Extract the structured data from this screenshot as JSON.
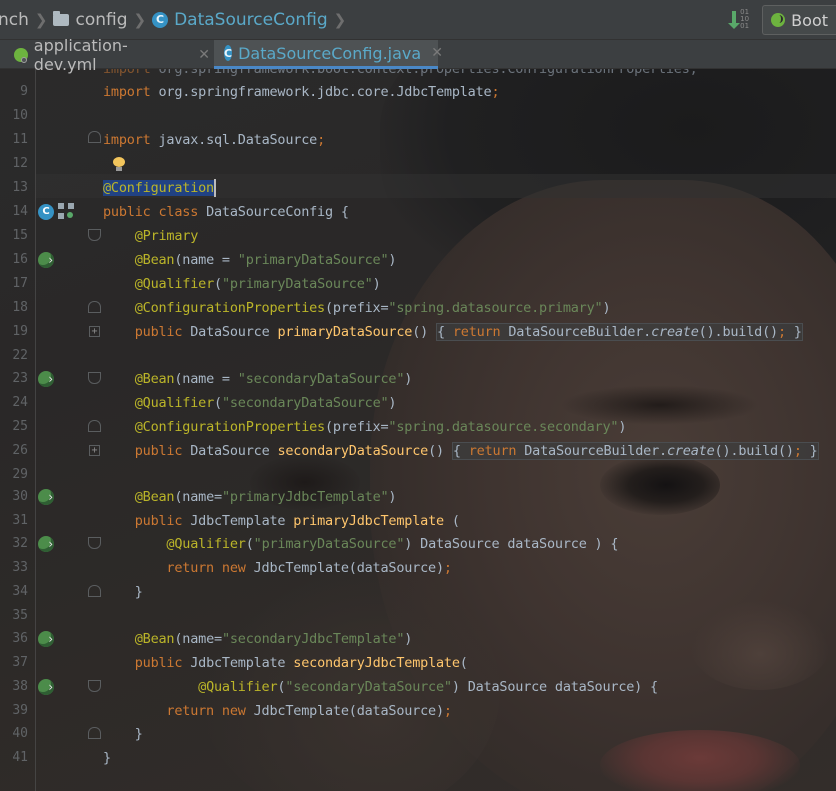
{
  "breadcrumb": {
    "items": [
      {
        "label": "nch",
        "icon": ""
      },
      {
        "label": "config",
        "icon": "folder-icon"
      },
      {
        "label": "DataSourceConfig",
        "icon": "class-icon"
      }
    ]
  },
  "toolbar": {
    "vcs_icon": "vcs-update-icon",
    "boot_label": "Boot"
  },
  "tabs": [
    {
      "label": "application-dev.yml",
      "icon": "yaml-spring-icon",
      "active": false
    },
    {
      "label": "DataSourceConfig.java",
      "icon": "class-icon",
      "active": true
    }
  ],
  "editor": {
    "current_line": 13,
    "lines": [
      {
        "n": "9",
        "text": "import org.springframework.jdbc.core.JdbcTemplate;"
      },
      {
        "n": "10",
        "text": ""
      },
      {
        "n": "11",
        "text": "import javax.sql.DataSource;"
      },
      {
        "n": "12",
        "text": ""
      },
      {
        "n": "13",
        "text": "@Configuration"
      },
      {
        "n": "14",
        "text": "public class DataSourceConfig {"
      },
      {
        "n": "15",
        "text": "    @Primary"
      },
      {
        "n": "16",
        "text": "    @Bean(name = \"primaryDataSource\")"
      },
      {
        "n": "17",
        "text": "    @Qualifier(\"primaryDataSource\")"
      },
      {
        "n": "18",
        "text": "    @ConfigurationProperties(prefix=\"spring.datasource.primary\")"
      },
      {
        "n": "19",
        "text": "    public DataSource primaryDataSource() { return DataSourceBuilder.create().build(); }"
      },
      {
        "n": "22",
        "text": ""
      },
      {
        "n": "23",
        "text": "    @Bean(name = \"secondaryDataSource\")"
      },
      {
        "n": "24",
        "text": "    @Qualifier(\"secondaryDataSource\")"
      },
      {
        "n": "25",
        "text": "    @ConfigurationProperties(prefix=\"spring.datasource.secondary\")"
      },
      {
        "n": "26",
        "text": "    public DataSource secondaryDataSource() { return DataSourceBuilder.create().build(); }"
      },
      {
        "n": "29",
        "text": ""
      },
      {
        "n": "30",
        "text": "    @Bean(name=\"primaryJdbcTemplate\")"
      },
      {
        "n": "31",
        "text": "    public JdbcTemplate primaryJdbcTemplate ("
      },
      {
        "n": "32",
        "text": "        @Qualifier(\"primaryDataSource\") DataSource dataSource ) {"
      },
      {
        "n": "33",
        "text": "        return new JdbcTemplate(dataSource);"
      },
      {
        "n": "34",
        "text": "    }"
      },
      {
        "n": "35",
        "text": ""
      },
      {
        "n": "36",
        "text": "    @Bean(name=\"secondaryJdbcTemplate\")"
      },
      {
        "n": "37",
        "text": "    public JdbcTemplate secondaryJdbcTemplate("
      },
      {
        "n": "38",
        "text": "            @Qualifier(\"secondaryDataSource\") DataSource dataSource) {"
      },
      {
        "n": "39",
        "text": "        return new JdbcTemplate(dataSource);"
      },
      {
        "n": "40",
        "text": "    }"
      },
      {
        "n": "41",
        "text": "}"
      }
    ]
  },
  "colors": {
    "keyword": "#cc7832",
    "annotation": "#bbb529",
    "string": "#6a8759",
    "plain": "#a9b7c6",
    "function": "#ffc66d",
    "line_number": "#606366",
    "selection": "#214283",
    "active_tab_text": "#5aa9c9"
  }
}
